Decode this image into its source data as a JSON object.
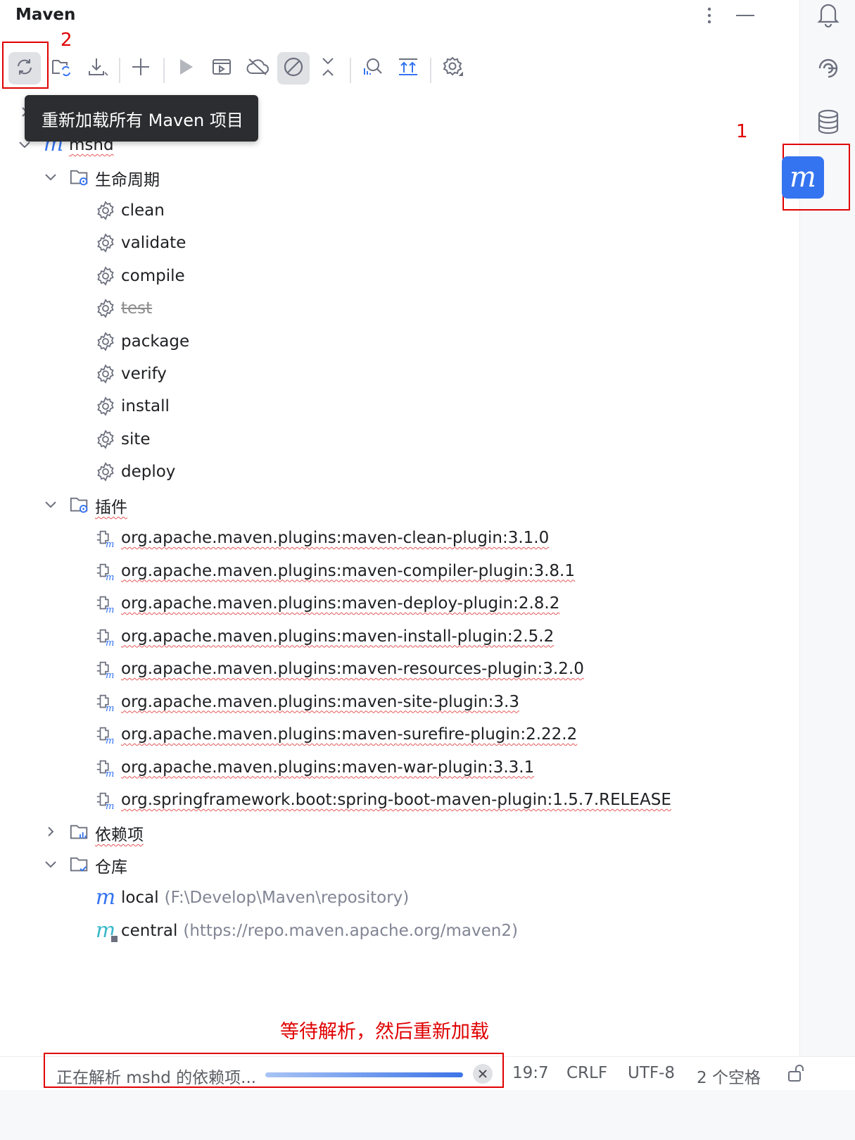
{
  "panel": {
    "title": "Maven"
  },
  "header_icons": [
    "more-vertical-icon",
    "minimize-icon"
  ],
  "toolbar": {
    "buttons": [
      "reload-all-icon",
      "reimport-folder-icon",
      "download-icon",
      "add-icon",
      "run-icon",
      "run-config-icon",
      "offline-icon",
      "skip-tests-icon",
      "collapse-all-icon",
      "analyze-deps-icon",
      "show-deps-icon",
      "settings-icon"
    ],
    "tooltip": "重新加载所有 Maven 项目"
  },
  "annotations": {
    "num1": "1",
    "num2": "2",
    "note": "等待解析，然后重新加载"
  },
  "tree": {
    "root": "mshd",
    "lifecycle": {
      "label": "生命周期",
      "items": [
        "clean",
        "validate",
        "compile",
        "test",
        "package",
        "verify",
        "install",
        "site",
        "deploy"
      ],
      "disabled": [
        "test"
      ]
    },
    "plugins": {
      "label": "插件",
      "items": [
        "org.apache.maven.plugins:maven-clean-plugin:3.1.0",
        "org.apache.maven.plugins:maven-compiler-plugin:3.8.1",
        "org.apache.maven.plugins:maven-deploy-plugin:2.8.2",
        "org.apache.maven.plugins:maven-install-plugin:2.5.2",
        "org.apache.maven.plugins:maven-resources-plugin:3.2.0",
        "org.apache.maven.plugins:maven-site-plugin:3.3",
        "org.apache.maven.plugins:maven-surefire-plugin:2.22.2",
        "org.apache.maven.plugins:maven-war-plugin:3.3.1",
        "org.springframework.boot:spring-boot-maven-plugin:1.5.7.RELEASE"
      ]
    },
    "dependencies": {
      "label": "依赖项"
    },
    "repositories": {
      "label": "仓库",
      "items": [
        {
          "name": "local",
          "path": "(F:\\Develop\\Maven\\repository)"
        },
        {
          "name": "central",
          "path": "(https://repo.maven.apache.org/maven2)"
        }
      ]
    }
  },
  "status": {
    "task": "正在解析 mshd 的依赖项...",
    "progress": 0.97,
    "position": "19:7",
    "line_ending": "CRLF",
    "encoding": "UTF-8",
    "indent": "2 个空格"
  },
  "sidebar_icons": [
    "notifications-icon",
    "ai-assistant-icon",
    "database-icon",
    "maven-icon"
  ],
  "colors": {
    "accent": "#3574f0",
    "annotation": "#e00000",
    "tooltip_bg": "#2b2d30"
  }
}
